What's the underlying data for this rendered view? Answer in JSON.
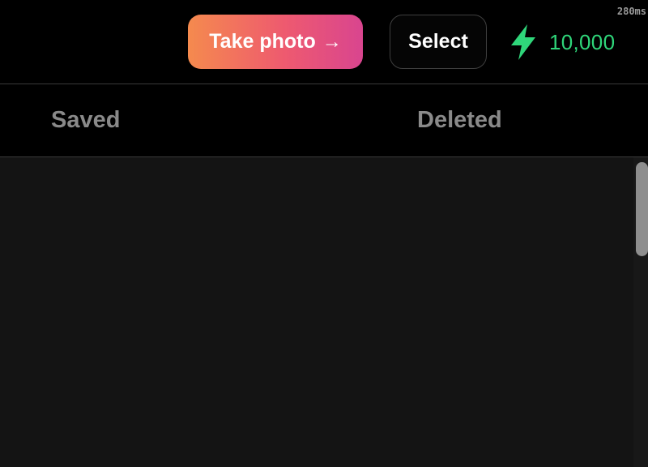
{
  "debug": {
    "timing": "280ms"
  },
  "header": {
    "take_photo": {
      "label": "Take photo",
      "arrow": "→"
    },
    "select_label": "Select",
    "credits": {
      "icon": "lightning-bolt-icon",
      "value": "10,000",
      "color": "#2fd67a"
    }
  },
  "tabs": [
    {
      "label": "Saved"
    },
    {
      "label": "Deleted"
    }
  ],
  "colors": {
    "background": "#000000",
    "content_background": "#141414",
    "take_photo_gradient": [
      "#f58a4e",
      "#ee5a6f",
      "#d9458f"
    ],
    "tab_text": "#8a8a8a"
  }
}
